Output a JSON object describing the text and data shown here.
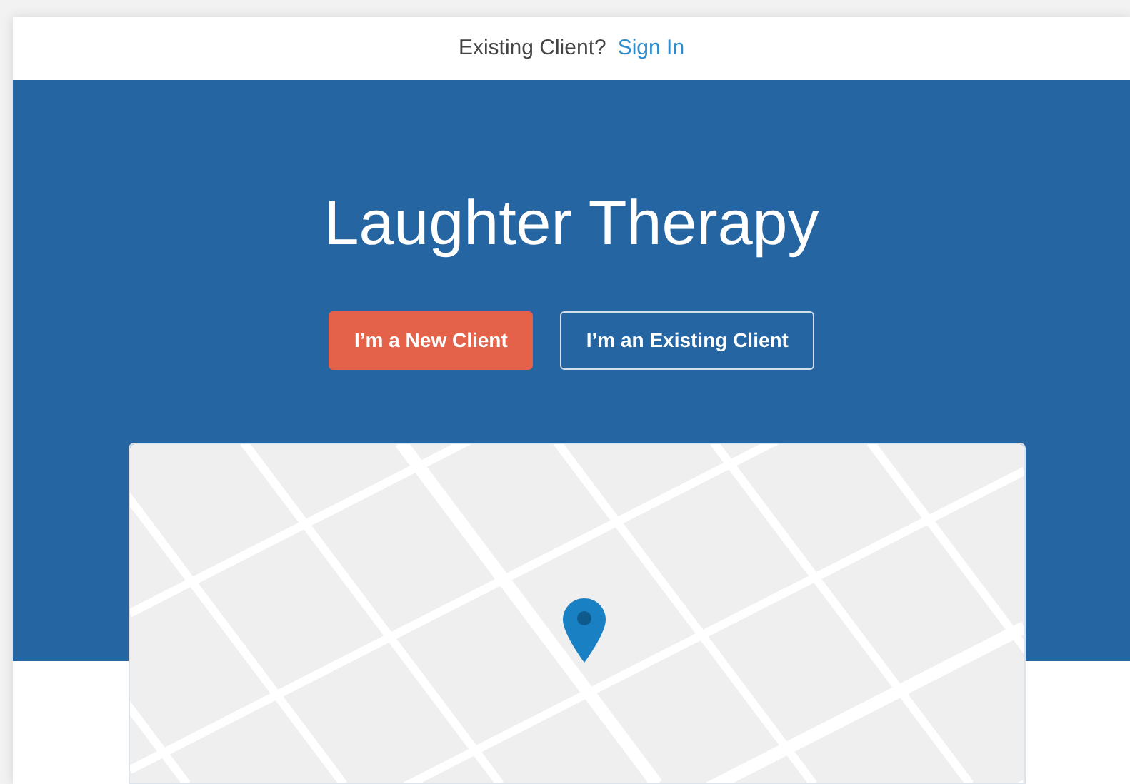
{
  "top_bar": {
    "prompt": "Existing Client?",
    "link": "Sign In"
  },
  "hero": {
    "title": "Laughter Therapy",
    "buttons": [
      {
        "label": "I’m a New Client",
        "kind": "primary"
      },
      {
        "label": "I’m an Existing Client",
        "kind": "outline"
      }
    ]
  }
}
